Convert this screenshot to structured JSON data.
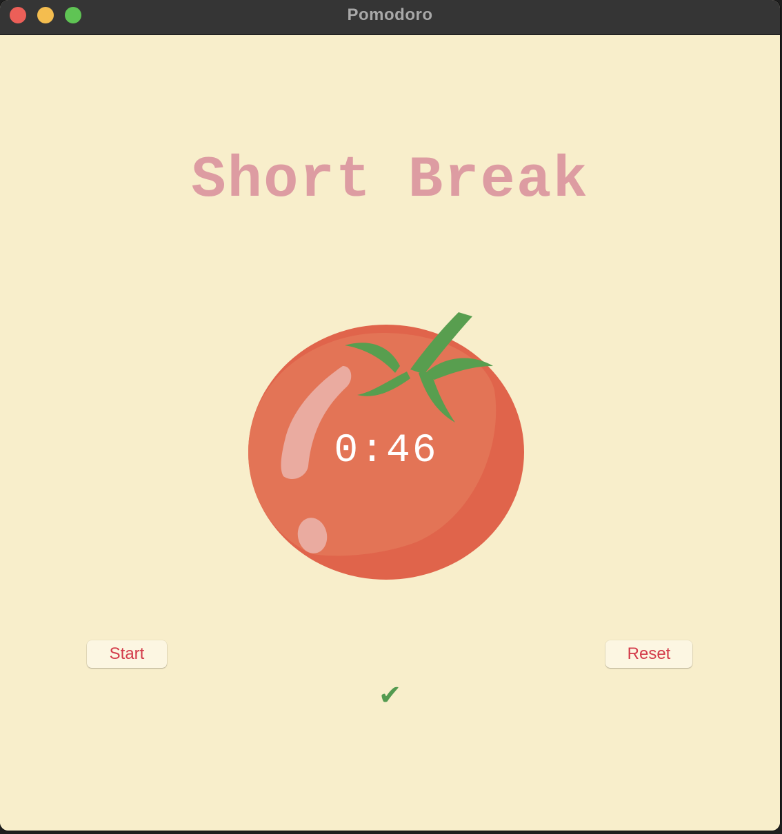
{
  "window": {
    "title": "Pomodoro",
    "controls": [
      "close",
      "minimize",
      "maximize"
    ]
  },
  "main": {
    "heading": "Short Break",
    "timer": "0:46",
    "start_label": "Start",
    "reset_label": "Reset",
    "checkmarks": "✔"
  },
  "colors": {
    "background": "#f8eecb",
    "heading": "#dd9ca2",
    "tomato": "#e2725a",
    "leaf": "#5a9e50",
    "button_text": "#d33b4a",
    "checkmark": "#539a50"
  },
  "icons": {
    "tomato": "tomato-icon",
    "check": "check-icon"
  }
}
